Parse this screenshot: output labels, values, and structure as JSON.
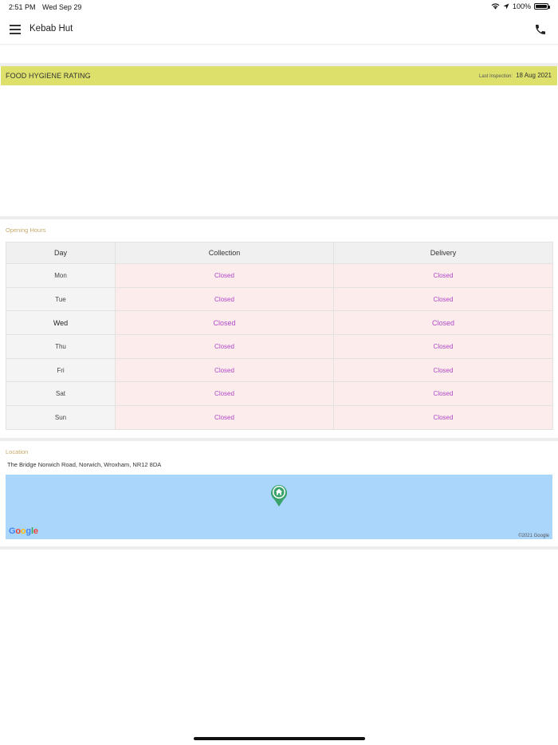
{
  "status_bar": {
    "time": "2:51 PM",
    "date": "Wed Sep 29",
    "battery": "100%",
    "battery_level": 1.0
  },
  "header": {
    "title": "Kebab Hut",
    "menu_icon": "hamburger-menu-icon",
    "phone_icon": "phone-icon"
  },
  "hygiene": {
    "title": "FOOD HYGIENE RATING",
    "last_inspection_label": "Last Inspection:",
    "last_inspection_date": "18 Aug 2021",
    "bar_color": "#dde06b"
  },
  "opening_hours": {
    "label": "Opening Hours",
    "columns": [
      "Day",
      "Collection",
      "Delivery"
    ],
    "rows": [
      {
        "day": "Mon",
        "collection": "Closed",
        "delivery": "Closed"
      },
      {
        "day": "Tue",
        "collection": "Closed",
        "delivery": "Closed"
      },
      {
        "day": "Wed",
        "collection": "Closed",
        "delivery": "Closed"
      },
      {
        "day": "Thu",
        "collection": "Closed",
        "delivery": "Closed"
      },
      {
        "day": "Fri",
        "collection": "Closed",
        "delivery": "Closed"
      },
      {
        "day": "Sat",
        "collection": "Closed",
        "delivery": "Closed"
      },
      {
        "day": "Sun",
        "collection": "Closed",
        "delivery": "Closed"
      }
    ]
  },
  "location": {
    "label": "Location",
    "address": "The Bridge Norwich Road, Norwich, Wroxham, NR12 8DA",
    "map_logo": "Google",
    "map_copyright": "©2021 Google",
    "pin_icon": "home-map-pin-icon",
    "pin_color": "#3aa36b"
  },
  "colors": {
    "label_gold": "#c7a96a",
    "closed_text": "#b048c8",
    "closed_bg": "#fdecec",
    "map_water": "#aad6fc"
  }
}
